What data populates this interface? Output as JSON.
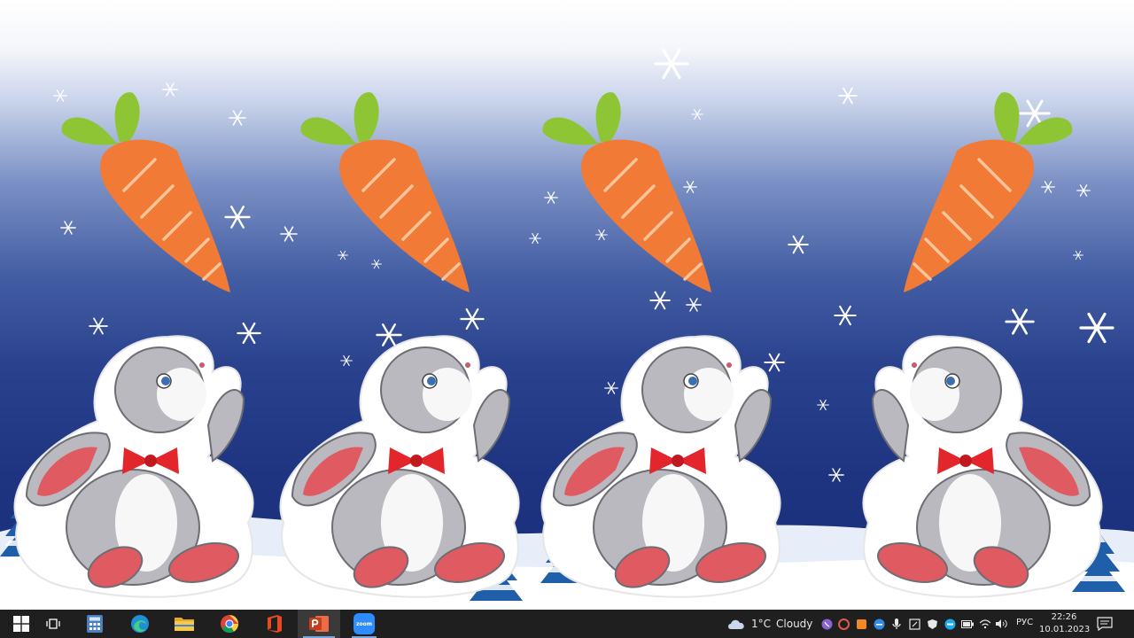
{
  "taskbar": {
    "zoom_label": "zoom",
    "weather": {
      "temperature": "1°C",
      "condition": "Cloudy"
    },
    "language": "РУС",
    "clock": {
      "time": "22:26",
      "date": "10.01.2023"
    }
  },
  "colors": {
    "taskbar": "#1f1f1f",
    "accent": "#7aa7d9",
    "carrot": "#f07a36",
    "leaf": "#8ec534",
    "sky_dark": "#1b2f7a"
  }
}
